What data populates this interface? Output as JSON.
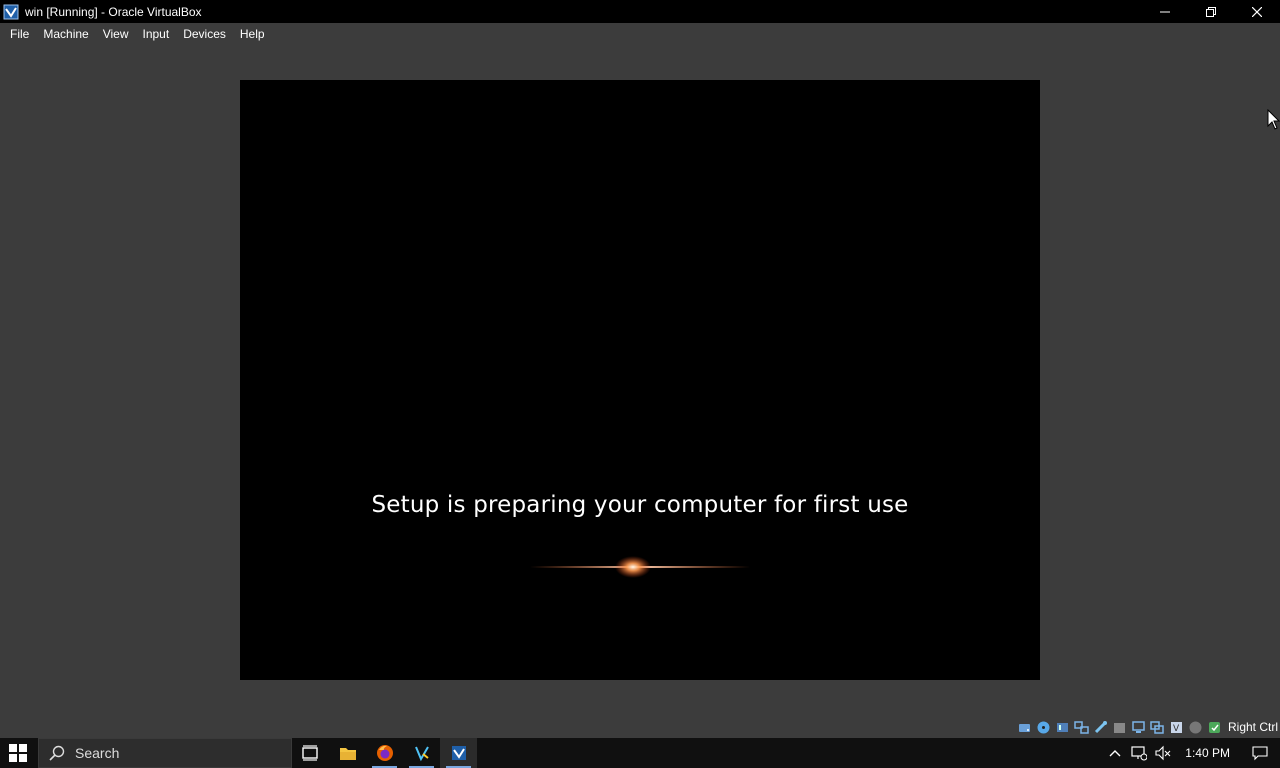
{
  "window": {
    "title": "win [Running] - Oracle VirtualBox"
  },
  "menu": {
    "items": [
      "File",
      "Machine",
      "View",
      "Input",
      "Devices",
      "Help"
    ]
  },
  "vm": {
    "setup_message": "Setup is preparing your computer for first use"
  },
  "status_bar": {
    "icons": [
      "hard-disk-icon",
      "optical-drive-icon",
      "audio-icon",
      "network-icon",
      "usb-icon",
      "shared-folders-icon",
      "display-icon",
      "recording-icon",
      "cpu-icon",
      "mouse-integration-icon",
      "keyboard-icon"
    ],
    "host_key": "Right Ctrl"
  },
  "taskbar": {
    "search_placeholder": "Search",
    "apps": [
      "task-view-icon",
      "file-explorer-icon",
      "firefox-icon",
      "vscode-icon",
      "virtualbox-icon"
    ],
    "clock": "1:40 PM"
  },
  "colors": {
    "title_bar": "#000000",
    "menu_bar": "#3c3c3c",
    "taskbar": "#101010",
    "accent": "#7aa7e0"
  }
}
